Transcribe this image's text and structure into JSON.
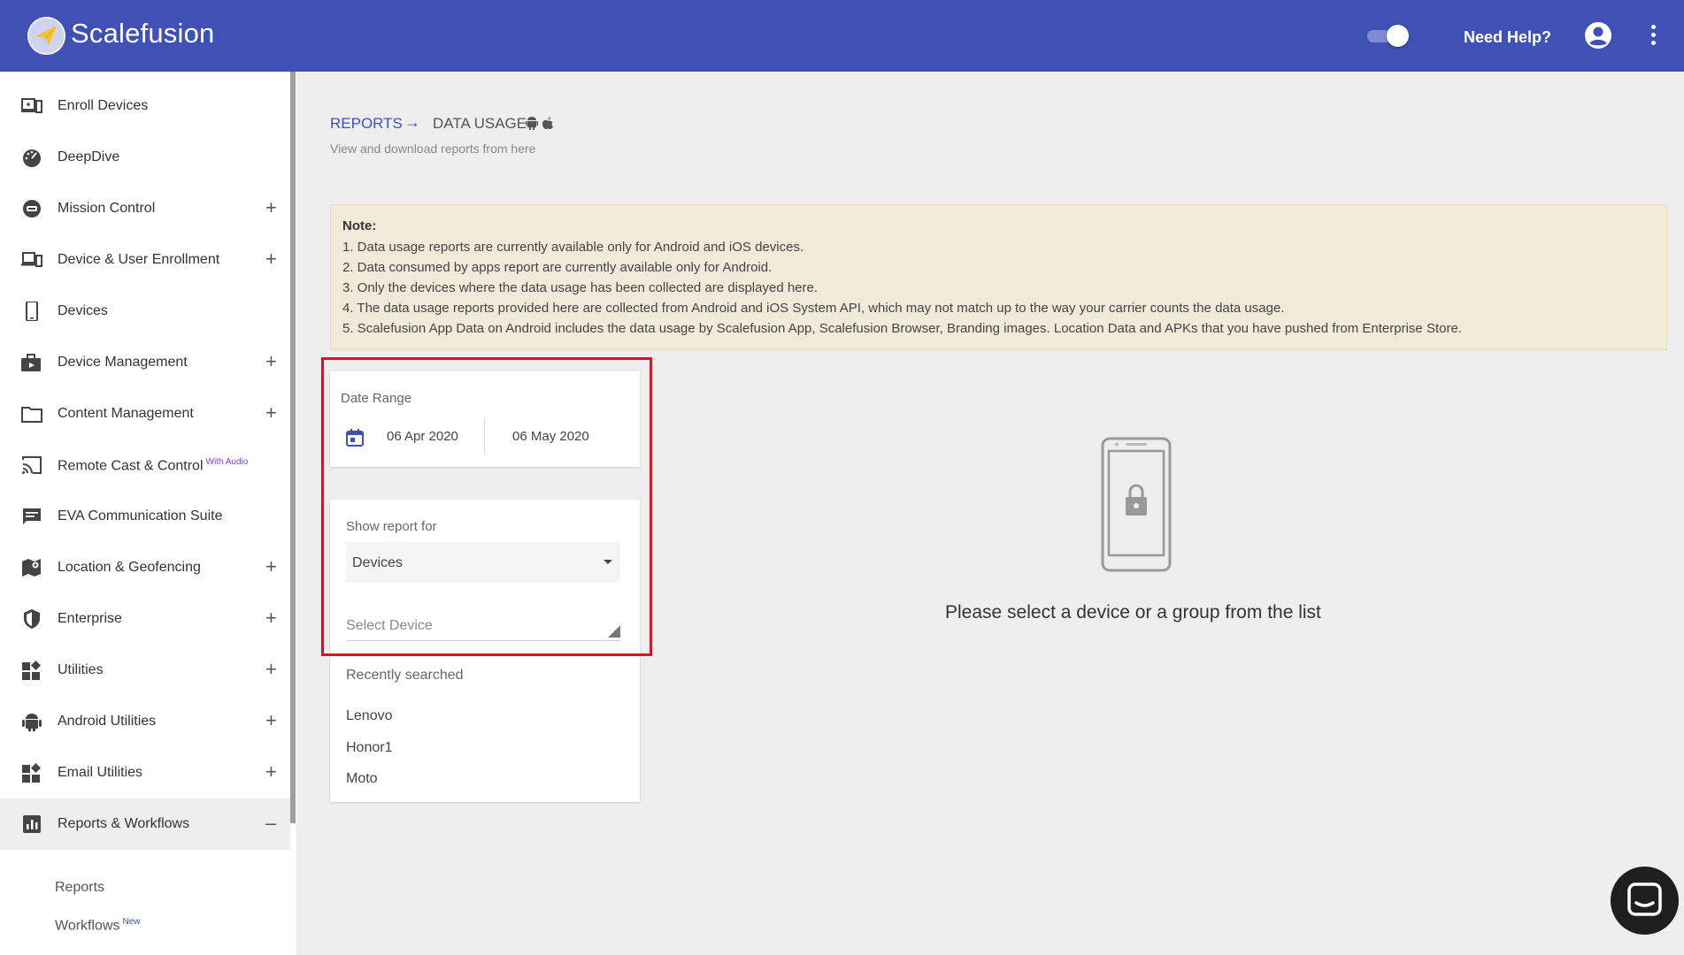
{
  "header": {
    "brand": "Scalefusion",
    "help_label": "Need Help?",
    "toggle_on": true,
    "colors": {
      "primary": "#3f51b5",
      "accent": "#fbc02d"
    }
  },
  "sidebar": {
    "items": [
      {
        "label": "Enroll Devices",
        "icon": "enroll-icon",
        "expandable": false
      },
      {
        "label": "DeepDive",
        "icon": "dashboard-icon",
        "expandable": false
      },
      {
        "label": "Mission Control",
        "icon": "mission-control-icon",
        "expandable": true
      },
      {
        "label": "Device & User Enrollment",
        "icon": "devices-enroll-icon",
        "expandable": true
      },
      {
        "label": "Devices",
        "icon": "phone-icon",
        "expandable": false
      },
      {
        "label": "Device Management",
        "icon": "briefcase-icon",
        "expandable": true
      },
      {
        "label": "Content Management",
        "icon": "folder-icon",
        "expandable": true
      },
      {
        "label": "Remote Cast & Control",
        "badge": "With Audio",
        "icon": "cast-icon",
        "expandable": false
      },
      {
        "label": "EVA Communication Suite",
        "icon": "chat-icon",
        "expandable": false
      },
      {
        "label": "Location & Geofencing",
        "icon": "map-icon",
        "expandable": true
      },
      {
        "label": "Enterprise",
        "icon": "shield-icon",
        "expandable": true
      },
      {
        "label": "Utilities",
        "icon": "widgets-icon",
        "expandable": true
      },
      {
        "label": "Android Utilities",
        "icon": "android-icon",
        "expandable": true
      },
      {
        "label": "Email Utilities",
        "icon": "widgets-icon",
        "expandable": true
      },
      {
        "label": "Reports & Workflows",
        "icon": "report-icon",
        "expandable": true,
        "expanded": true
      }
    ],
    "subitems": [
      {
        "label": "Reports"
      },
      {
        "label": "Workflows",
        "badge": "New"
      }
    ],
    "plus": "+",
    "minus": "–"
  },
  "breadcrumb": {
    "root": "REPORTS",
    "arrow": "→",
    "current": "DATA USAGE"
  },
  "subtitle": "View and download reports from here",
  "note": {
    "title": "Note:",
    "lines": [
      "1. Data usage reports are currently available only for Android and iOS devices.",
      "2. Data consumed by apps report are currently available only for Android.",
      "3. Only the devices where the data usage has been collected are displayed here.",
      "4. The data usage reports provided here are collected from Android and iOS System API, which may not match up to the way your carrier counts the data usage.",
      "5. Scalefusion App Data on Android includes the data usage by Scalefusion App, Scalefusion Browser, Branding images. Location Data and APKs that you have pushed from Enterprise Store."
    ]
  },
  "date_range": {
    "label": "Date Range",
    "start": "06 Apr 2020",
    "end": "06 May 2020"
  },
  "report_for": {
    "label": "Show report for",
    "selected": "Devices",
    "device_placeholder": "Select Device",
    "recent_title": "Recently searched",
    "recent": [
      "Lenovo",
      "Honor1",
      "Moto"
    ]
  },
  "empty_state": {
    "message": "Please select a device or a group from the list"
  }
}
